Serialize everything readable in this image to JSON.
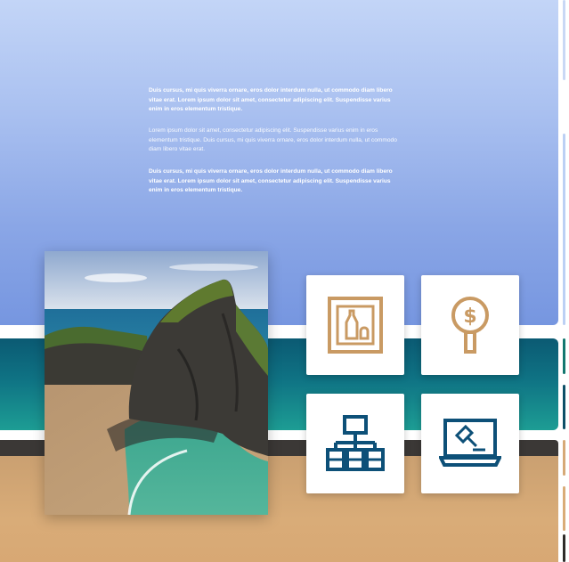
{
  "colors": {
    "sky_top": "#c3d5f7",
    "sky_bottom": "#7696e0",
    "sea": "#0f7384",
    "rock": "#3b3836",
    "sand": "#d9ac78",
    "icon_gold": "#c99a63",
    "icon_blue": "#0d5078"
  },
  "intro": {
    "paragraph_1": "Duis cursus, mi quis viverra ornare, eros dolor interdum nulla, ut commodo diam libero vitae erat. Lorem ipsum dolor sit amet, consectetur adipiscing elit. Suspendisse varius enim in eros elementum tristique.",
    "paragraph_2": "Lorem ipsum dolor sit amet, consectetur adipiscing elit. Suspendisse varius enim in eros elementum tristique. Duis cursus, mi quis viverra ornare, eros dolor interdum nulla, ut commodo diam libero vitae erat.",
    "paragraph_3": "Duis cursus, mi quis viverra ornare, eros dolor interdum nulla, ut commodo diam libero vitae erat. Lorem ipsum dolor sit amet, consectetur adipiscing elit. Suspendisse varius enim in eros elementum tristique."
  },
  "photo": {
    "subject": "coastal-rock-beach-photo"
  },
  "cards": [
    {
      "icon": "framed-artwork-icon"
    },
    {
      "icon": "dollar-sign-magnifier-icon"
    },
    {
      "icon": "org-chart-hierarchy-icon"
    },
    {
      "icon": "laptop-auction-gavel-icon"
    }
  ]
}
